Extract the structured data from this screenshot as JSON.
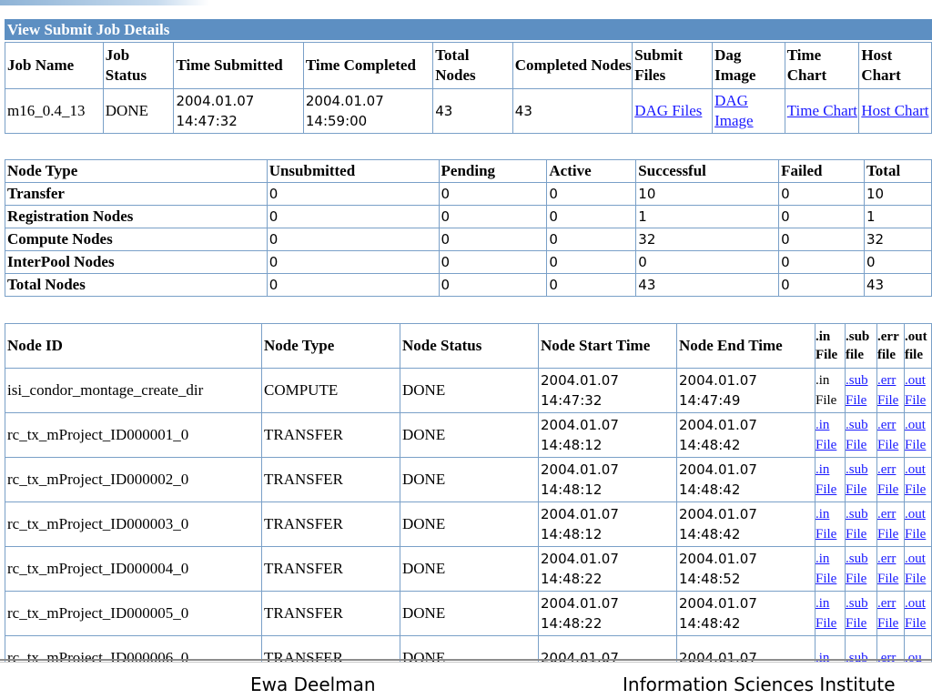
{
  "title": "View Submit Job Details",
  "job": {
    "headers": [
      "Job Name",
      "Job Status",
      "Time Submitted",
      "Time Completed",
      "Total Nodes",
      "Completed Nodes",
      "Submit Files",
      "Dag Image",
      "Time Chart",
      "Host Chart"
    ],
    "row": {
      "name": "m16_0.4_13",
      "status": "DONE",
      "submitted": "2004.01.07 14:47:32",
      "completed": "2004.01.07 14:59:00",
      "total_nodes": "43",
      "completed_nodes": "43",
      "submit_files": "DAG Files",
      "dag_image": "DAG Image",
      "time_chart": "Time Chart",
      "host_chart": "Host Chart"
    }
  },
  "summary": {
    "headers": [
      "Node Type",
      "Unsubmitted",
      "Pending",
      "Active",
      "Successful",
      "Failed",
      "Total"
    ],
    "rows": [
      [
        "Transfer",
        "0",
        "0",
        "0",
        "10",
        "0",
        "10"
      ],
      [
        "Registration Nodes",
        "0",
        "0",
        "0",
        "1",
        "0",
        "1"
      ],
      [
        "Compute Nodes",
        "0",
        "0",
        "0",
        "32",
        "0",
        "32"
      ],
      [
        "InterPool Nodes",
        "0",
        "0",
        "0",
        "0",
        "0",
        "0"
      ],
      [
        "Total Nodes",
        "0",
        "0",
        "0",
        "43",
        "0",
        "43"
      ]
    ]
  },
  "nodes": {
    "headers": [
      "Node ID",
      "Node Type",
      "Node Status",
      "Node Start Time",
      "Node End Time",
      ".in File",
      ".sub file",
      ".err file",
      ".out file"
    ],
    "rows": [
      {
        "id": "isi_condor_montage_create_dir",
        "type": "COMPUTE",
        "status": "DONE",
        "start": "2004.01.07 14:47:32",
        "end": "2004.01.07 14:47:49",
        "in": ".in File",
        "sub": ".sub File",
        "err": ".err File",
        "out": ".out File"
      },
      {
        "id": "rc_tx_mProject_ID000001_0",
        "type": "TRANSFER",
        "status": "DONE",
        "start": "2004.01.07 14:48:12",
        "end": "2004.01.07 14:48:42",
        "in": ".in File",
        "sub": ".sub File",
        "err": ".err File",
        "out": ".out File"
      },
      {
        "id": "rc_tx_mProject_ID000002_0",
        "type": "TRANSFER",
        "status": "DONE",
        "start": "2004.01.07 14:48:12",
        "end": "2004.01.07 14:48:42",
        "in": ".in File",
        "sub": ".sub File",
        "err": ".err File",
        "out": ".out File"
      },
      {
        "id": "rc_tx_mProject_ID000003_0",
        "type": "TRANSFER",
        "status": "DONE",
        "start": "2004.01.07 14:48:12",
        "end": "2004.01.07 14:48:42",
        "in": ".in File",
        "sub": ".sub File",
        "err": ".err File",
        "out": ".out File"
      },
      {
        "id": "rc_tx_mProject_ID000004_0",
        "type": "TRANSFER",
        "status": "DONE",
        "start": "2004.01.07 14:48:22",
        "end": "2004.01.07 14:48:52",
        "in": ".in File",
        "sub": ".sub File",
        "err": ".err File",
        "out": ".out File"
      },
      {
        "id": "rc_tx_mProject_ID000005_0",
        "type": "TRANSFER",
        "status": "DONE",
        "start": "2004.01.07 14:48:22",
        "end": "2004.01.07 14:48:42",
        "in": ".in File",
        "sub": ".sub File",
        "err": ".err File",
        "out": ".out File"
      },
      {
        "id": "rc_tx_mProject_ID000006_0",
        "type": "TRANSFER",
        "status": "DONE",
        "start": "2004.01.07",
        "end": "2004.01.07",
        "in": ".in",
        "sub": ".sub",
        "err": ".err",
        "out": ".ou"
      }
    ]
  },
  "footer": {
    "left": "Ewa Deelman",
    "right": "Information Sciences Institute"
  },
  "colors": {
    "title_bar": "#5d8fc2",
    "border": "#7aa0c8",
    "link": "#1a1aff"
  }
}
